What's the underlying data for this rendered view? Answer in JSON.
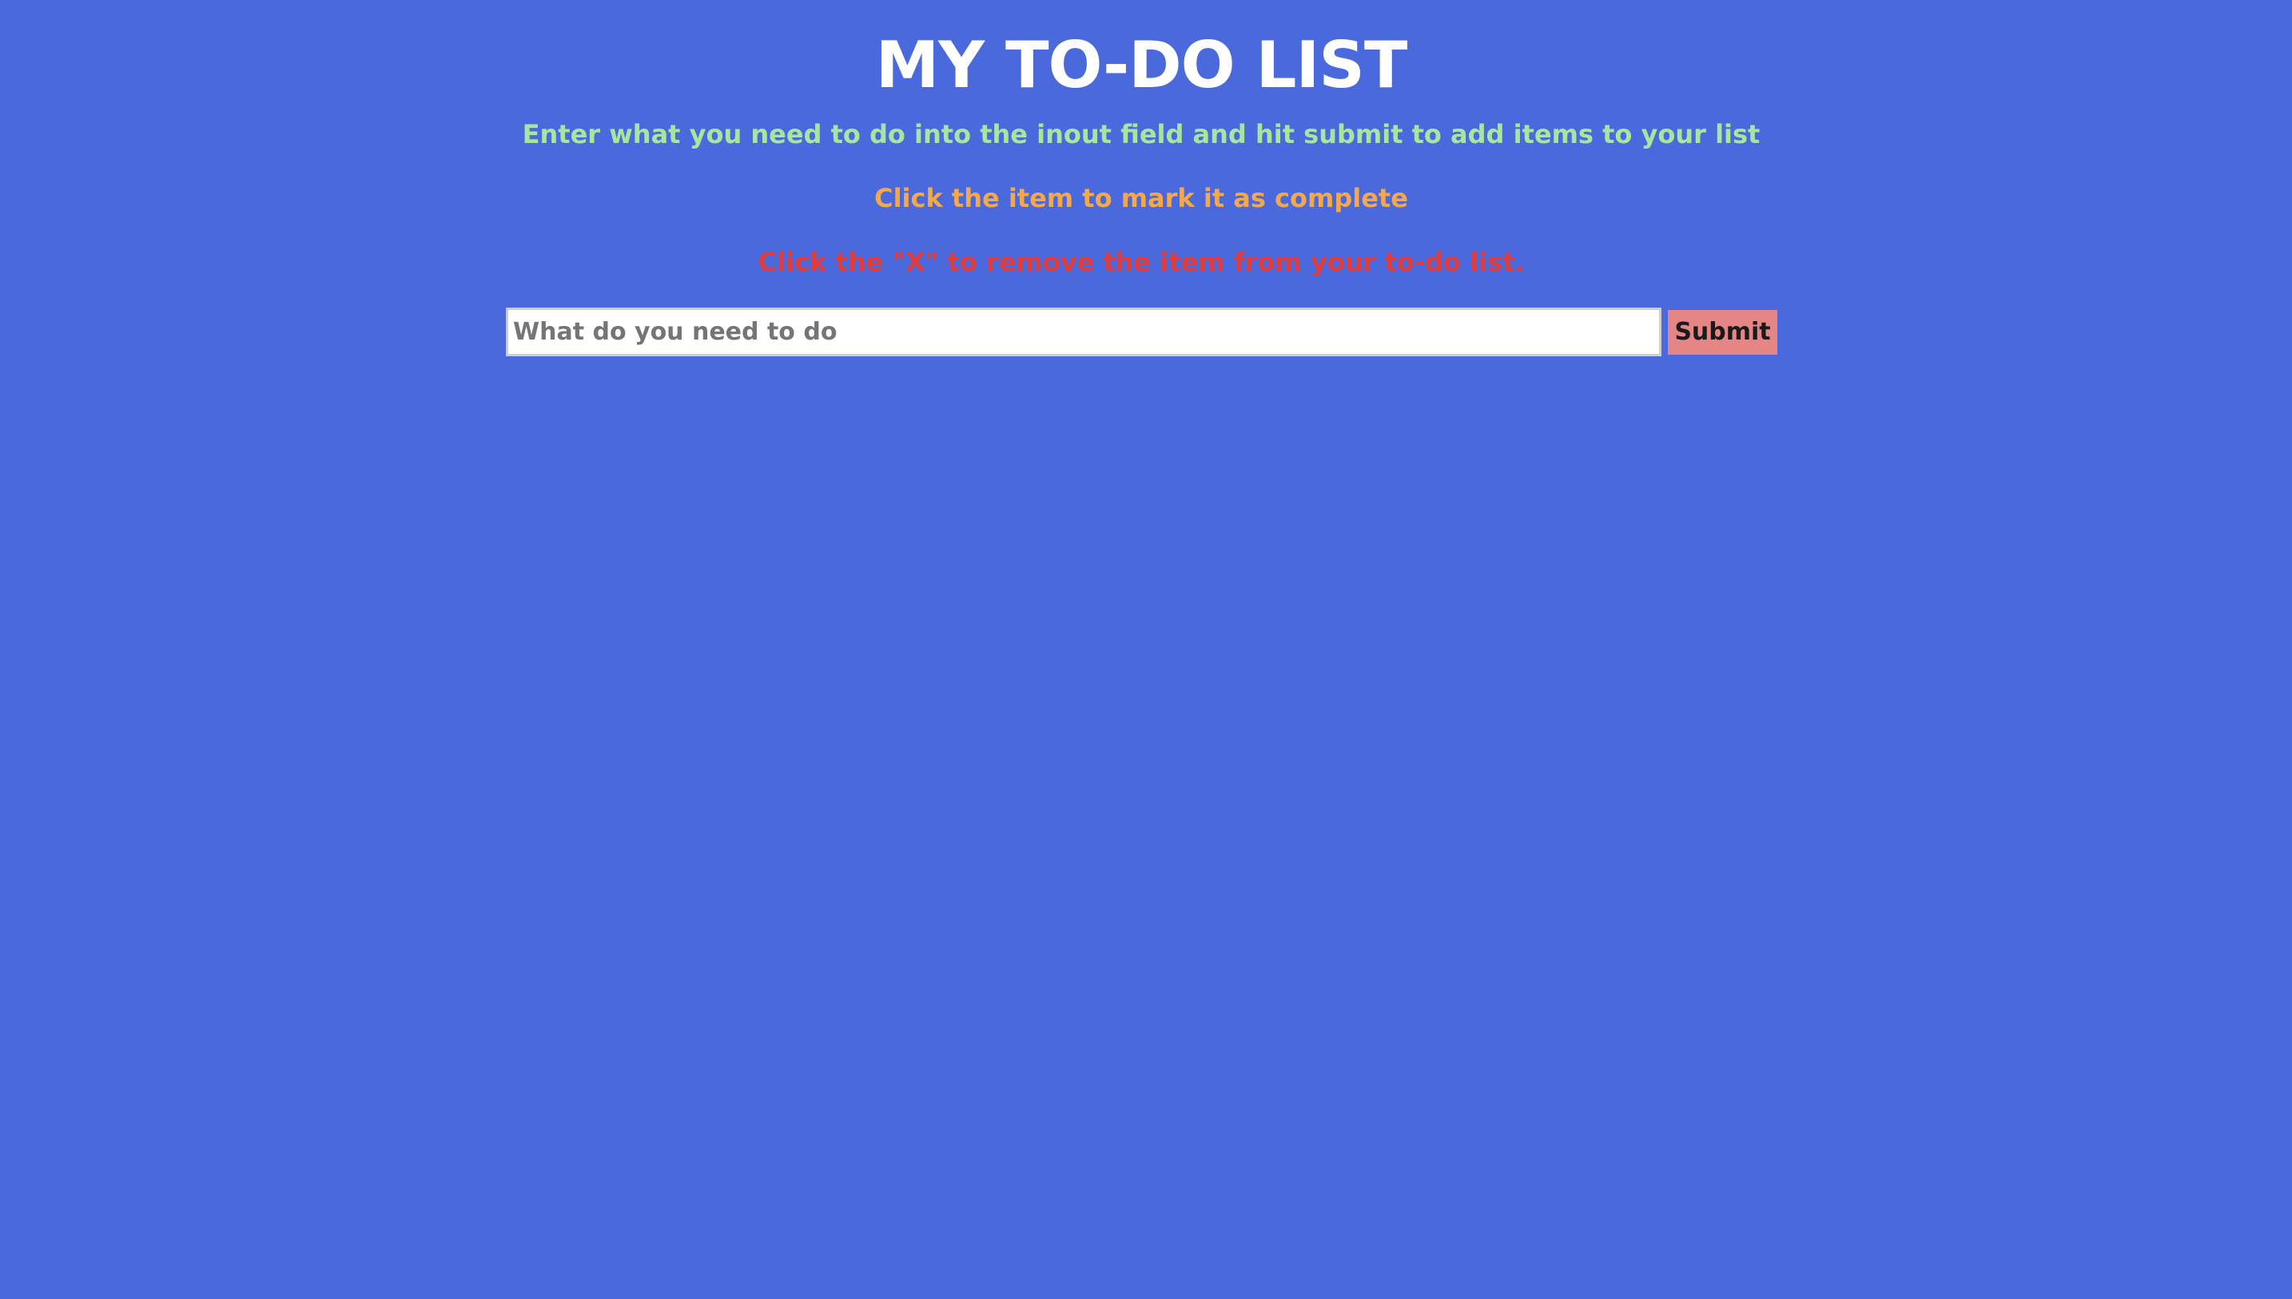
{
  "header": {
    "title": "MY TO-DO LIST"
  },
  "instructions": {
    "line1": "Enter what you need to do into the inout field and hit submit to add items to your list",
    "line2": "Click the item to mark it as complete",
    "line3": "Click the \"X\" to remove the item from your to-do list."
  },
  "form": {
    "input_value": "",
    "input_placeholder": "What do you need to do",
    "submit_label": "Submit"
  },
  "todo_items": [],
  "colors": {
    "background": "#4a69dc",
    "title": "#ffffff",
    "instruction_add": "#a8e6a0",
    "instruction_complete": "#f5a84a",
    "instruction_remove": "#e23b3b",
    "submit_button": "#e58585"
  }
}
